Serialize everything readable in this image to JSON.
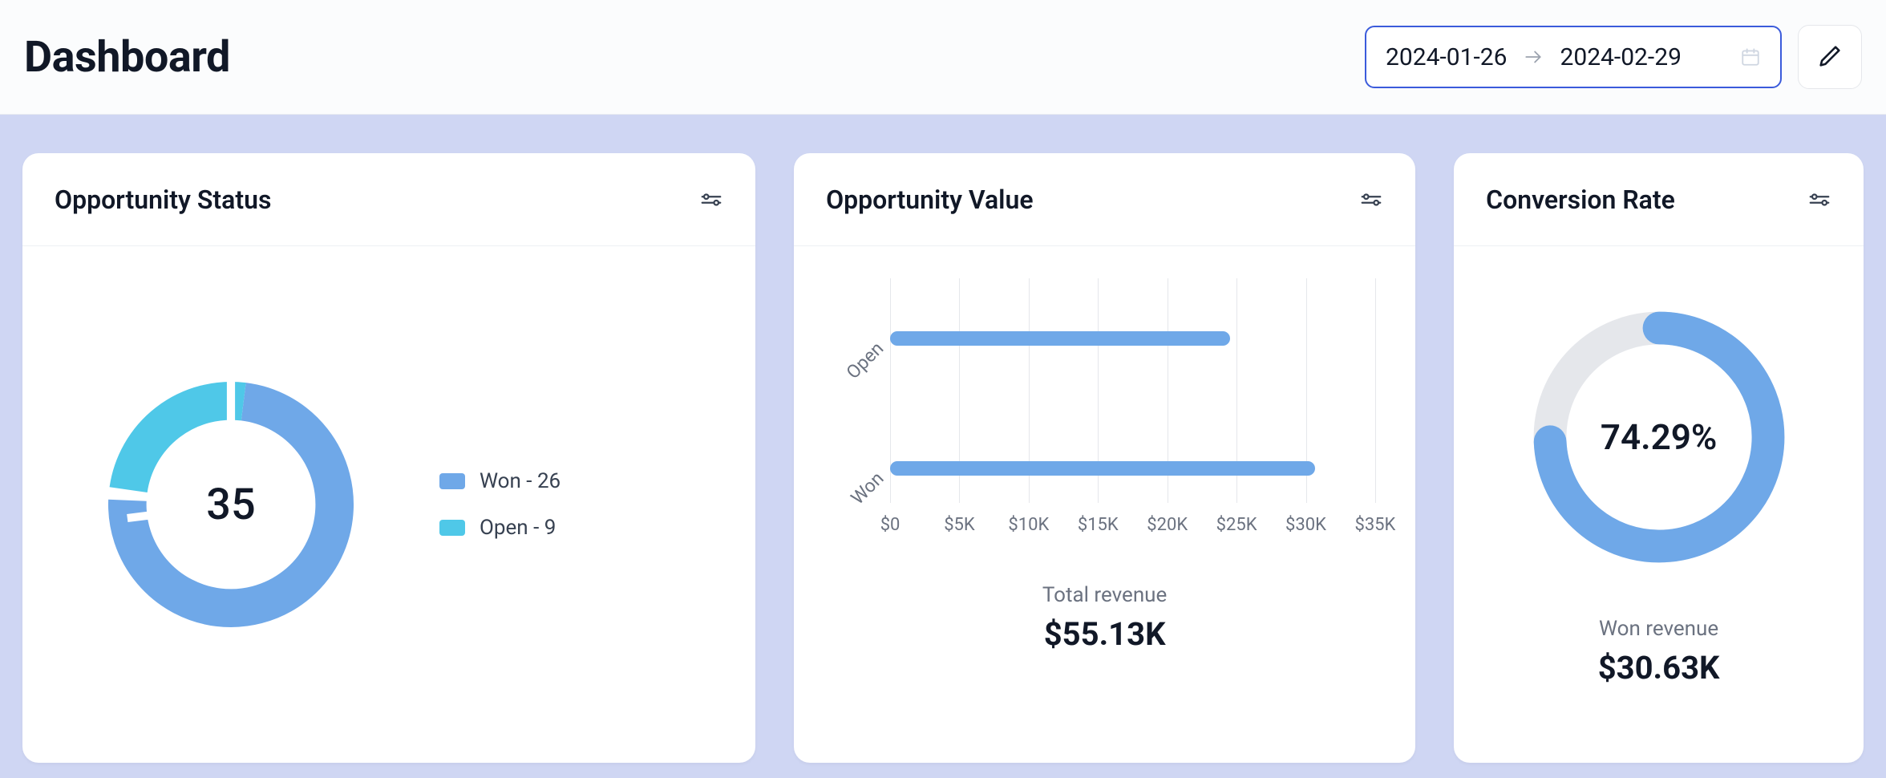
{
  "header": {
    "title": "Dashboard",
    "date_range": {
      "start": "2024-01-26",
      "end": "2024-02-29"
    }
  },
  "cards": {
    "opportunity_status": {
      "title": "Opportunity Status",
      "total": "35",
      "legend": {
        "won": "Won - 26",
        "open": "Open - 9"
      }
    },
    "opportunity_value": {
      "title": "Opportunity Value",
      "y_labels": {
        "open": "Open",
        "won": "Won"
      },
      "x_ticks": [
        "$0",
        "$5K",
        "$10K",
        "$15K",
        "$20K",
        "$25K",
        "$30K",
        "$35K"
      ],
      "stat_label": "Total revenue",
      "stat_value": "$55.13K"
    },
    "conversion_rate": {
      "title": "Conversion Rate",
      "value": "74.29%",
      "stat_label": "Won revenue",
      "stat_value": "$30.63K"
    }
  },
  "colors": {
    "won": "#6fa8e8",
    "open": "#4fc8e8",
    "track": "#e5e7eb",
    "border_accent": "#3b5bdb"
  },
  "chart_data": [
    {
      "type": "pie",
      "title": "Opportunity Status",
      "series": [
        {
          "name": "Won",
          "value": 26,
          "color": "#6fa8e8"
        },
        {
          "name": "Open",
          "value": 9,
          "color": "#4fc8e8"
        }
      ],
      "total": 35
    },
    {
      "type": "bar",
      "orientation": "horizontal",
      "title": "Opportunity Value",
      "xlabel": "",
      "ylabel": "",
      "categories": [
        "Open",
        "Won"
      ],
      "values": [
        24500,
        30630
      ],
      "xlim": [
        0,
        35000
      ],
      "x_ticks": [
        0,
        5000,
        10000,
        15000,
        20000,
        25000,
        30000,
        35000
      ],
      "total_revenue": 55130
    },
    {
      "type": "gauge",
      "title": "Conversion Rate",
      "value": 74.29,
      "min": 0,
      "max": 100,
      "unit": "%",
      "won_revenue": 30630
    }
  ]
}
